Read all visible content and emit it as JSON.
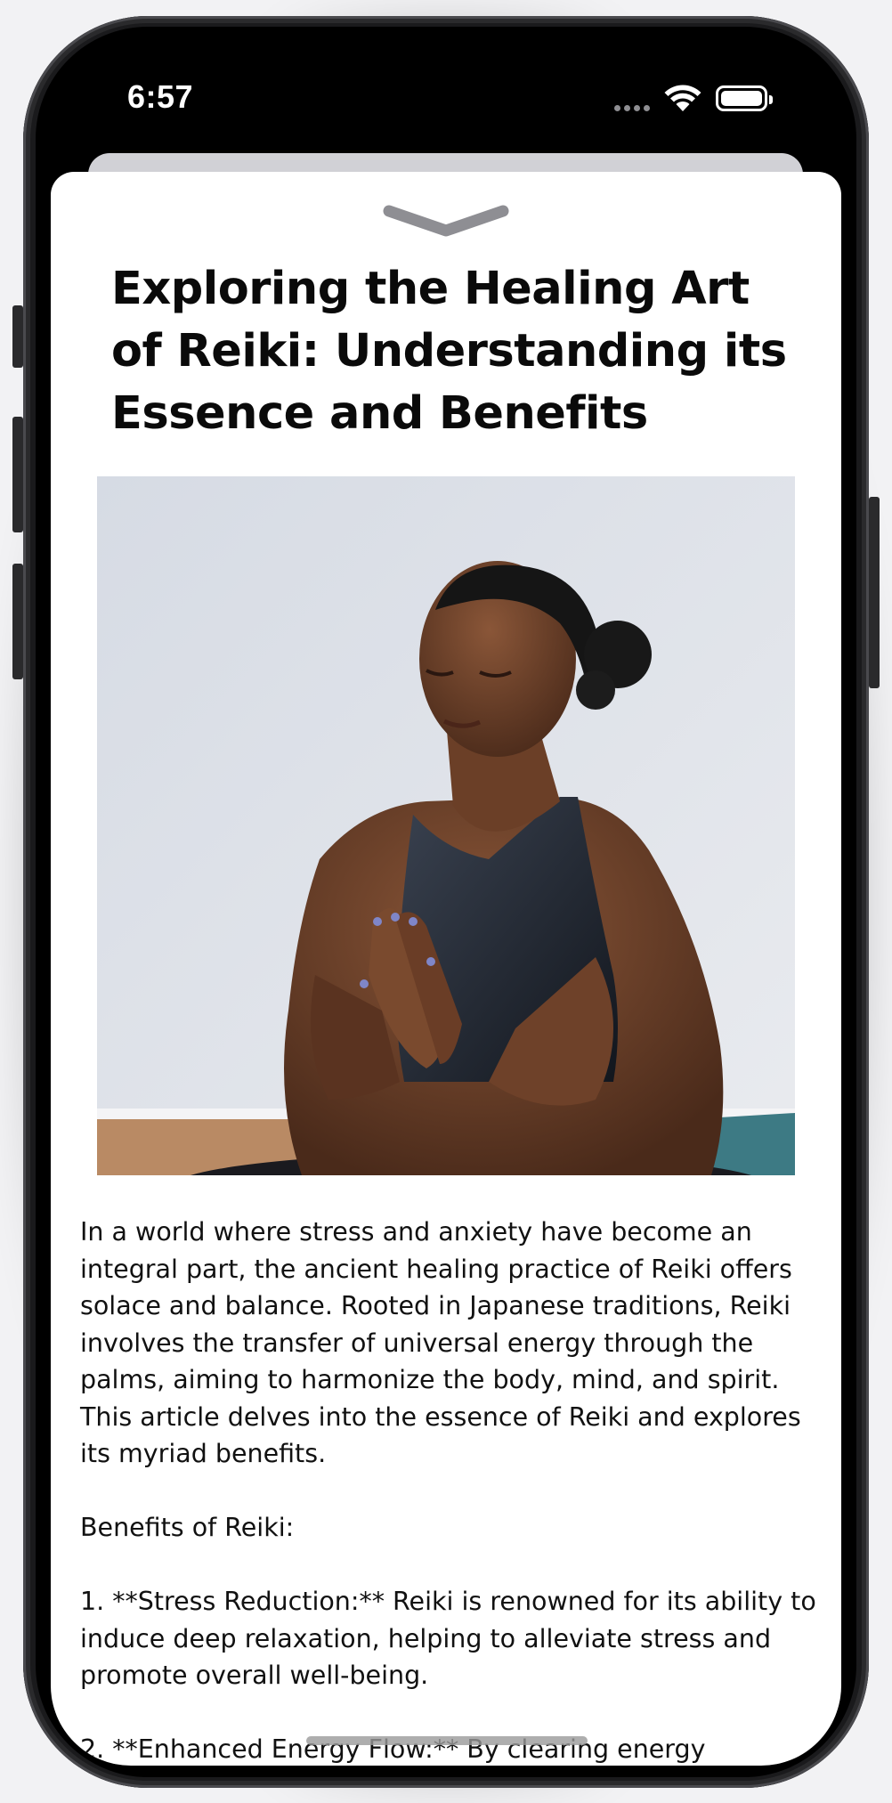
{
  "status_bar": {
    "time": "6:57",
    "icons": [
      "cellular-signal-icon",
      "wifi-icon",
      "battery-icon"
    ]
  },
  "sheet": {
    "grabber_icon": "chevron-down-icon",
    "title": "Exploring the Healing Art of Reiki: Understanding its Essence and Benefits",
    "hero_image": "woman-meditating-hands-in-prayer",
    "body": {
      "intro": "In a world where stress and anxiety have become an integral part, the ancient healing practice of Reiki offers solace and balance. Rooted in Japanese traditions, Reiki involves the transfer of universal energy through the palms, aiming to harmonize the body, mind, and spirit. This article delves into the essence of Reiki and explores its myriad benefits.",
      "benefits_heading": "Benefits of Reiki:",
      "benefit_1": "1. **Stress Reduction:** Reiki is renowned for its ability to induce deep relaxation, helping to alleviate stress and promote overall well-being.",
      "benefit_2": "2. **Enhanced Energy Flow:** By clearing energy"
    }
  },
  "colors": {
    "screen_bg": "#000000",
    "sheet_bg": "#ffffff",
    "back_card": "#d1d1d6",
    "text": "#111111",
    "grabber": "#8e8e93"
  }
}
